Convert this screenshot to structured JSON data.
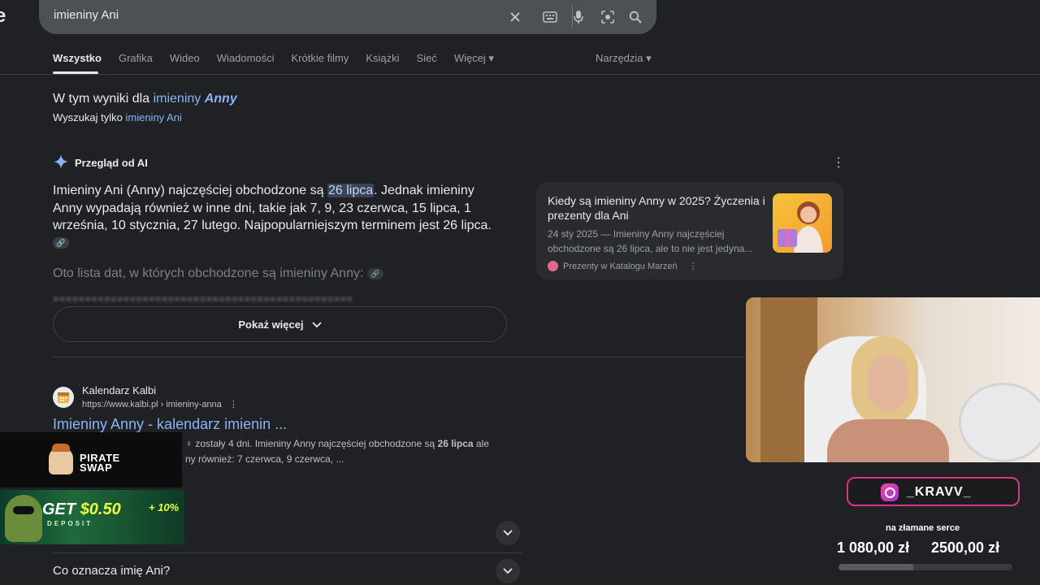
{
  "search": {
    "query": "imieniny Ani",
    "logo_fragment": "e"
  },
  "tabs": [
    {
      "label": "Wszystko",
      "active": true
    },
    {
      "label": "Grafika"
    },
    {
      "label": "Wideo"
    },
    {
      "label": "Wiadomości"
    },
    {
      "label": "Krótkie filmy"
    },
    {
      "label": "Książki"
    },
    {
      "label": "Sieć"
    },
    {
      "label": "Więcej ▾"
    }
  ],
  "tools_label": "Narzędzia ▾",
  "correction": {
    "prefix": "W tym wyniki dla",
    "link_plain": "imieniny",
    "link_bold": "Anny",
    "only_prefix": "Wyszukaj tylko",
    "only_link": "imieniny Ani"
  },
  "ai_overview": {
    "heading": "Przegląd od AI",
    "text_before": "Imieniny Ani (Anny) najczęściej obchodzone są ",
    "highlight": "26 lipca",
    "text_after": ". Jednak imieniny Anny wypadają również w inne dni, takie jak 7, 9, 23 czerwca, 15 lipca, 1 września, 10 stycznia, 27 lutego. Najpopularniejszym terminem jest 26 lipca.",
    "list_heading": "Oto lista dat, w których obchodzone są imieniny Anny:",
    "show_more": "Pokaż więcej"
  },
  "source_card": {
    "title": "Kiedy są imieniny Anny w 2025? Życzenia i prezenty dla Ani",
    "snippet": "24 sty 2025 — Imieniny Anny najczęściej obchodzone są 26 lipca, ale to nie jest jedyna...",
    "site": "Prezenty w Katalogu Marzeń"
  },
  "result": {
    "site": "Kalendarz Kalbi",
    "url": "https://www.kalbi.pl › imieniny-anna",
    "title": "Imieniny Anny - kalendarz imienin ...",
    "snippet_line1_a": "♀ zostały 4 dni. Imieniny Anny najczęściej obchodzone są ",
    "snippet_line1_b": "26 lipca",
    "snippet_line1_c": " ale",
    "snippet_line2": "ny również: 7 czerwca, 9 czerwca, ..."
  },
  "paa": {
    "question": "Co oznacza imię Ani?"
  },
  "overlay": {
    "sponsor_line1": "PIRATE",
    "sponsor_line2": "SWAP",
    "promo_get": "GET",
    "promo_amount": "$0.50",
    "promo_plus": "+ 10%",
    "promo_sub": "DEPOSIT",
    "instagram": "_KRAVV_",
    "goal_label": "na złamane serce",
    "goal_current": "1 080,00 zł",
    "goal_target": "2500,00 zł",
    "goal_progress": 0.432
  }
}
